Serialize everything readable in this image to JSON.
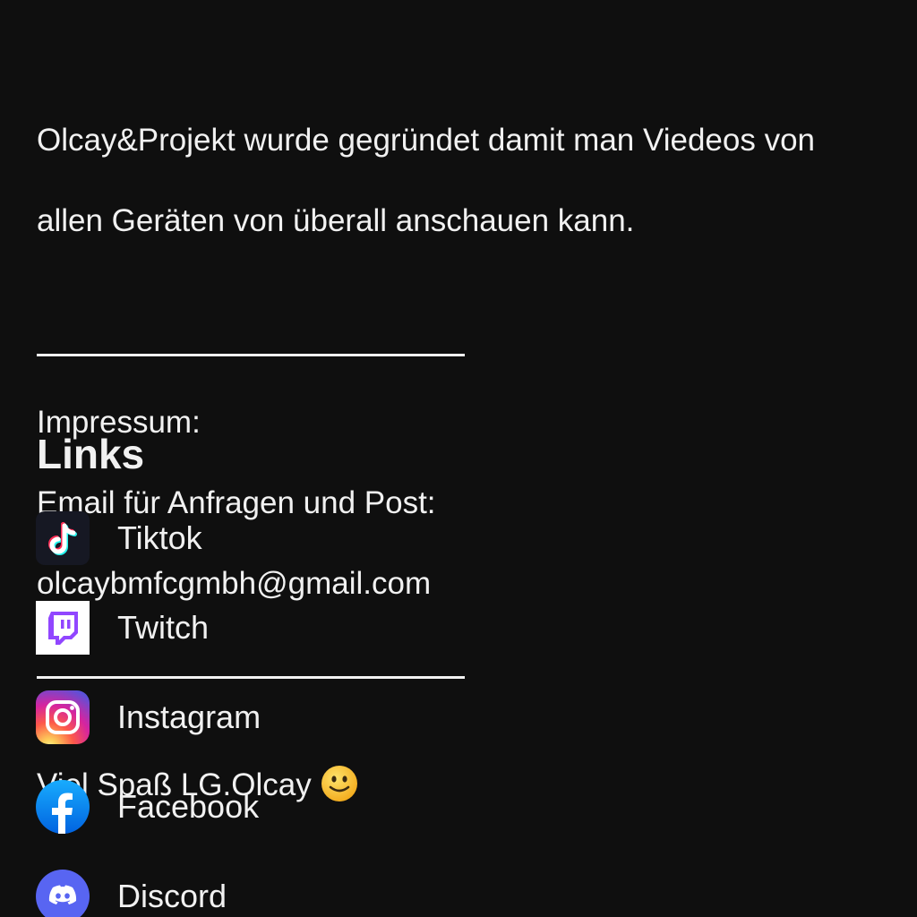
{
  "about": {
    "description_line1": "Olcay&Projekt wurde gegründet damit man Viedeos von",
    "description_line2": "allen Geräten von überall anschauen kann.",
    "impressum_label": "Impressum:",
    "email_label": "Email für Anfragen und Post:",
    "email": "olcaybmfcgmbh@gmail.com",
    "signoff": "Viel Spaß LG.Olcay"
  },
  "links": {
    "heading": "Links",
    "items": [
      {
        "label": "Tiktok",
        "icon": "tiktok-icon"
      },
      {
        "label": "Twitch",
        "icon": "twitch-icon"
      },
      {
        "label": "Instagram",
        "icon": "instagram-icon"
      },
      {
        "label": "Facebook",
        "icon": "facebook-icon"
      },
      {
        "label": "Discord",
        "icon": "discord-icon"
      }
    ]
  },
  "colors": {
    "background": "#0f0f0f",
    "text": "#f1f1f1",
    "twitch": "#9146ff",
    "facebook": "#1877f2",
    "discord": "#5865f2"
  }
}
